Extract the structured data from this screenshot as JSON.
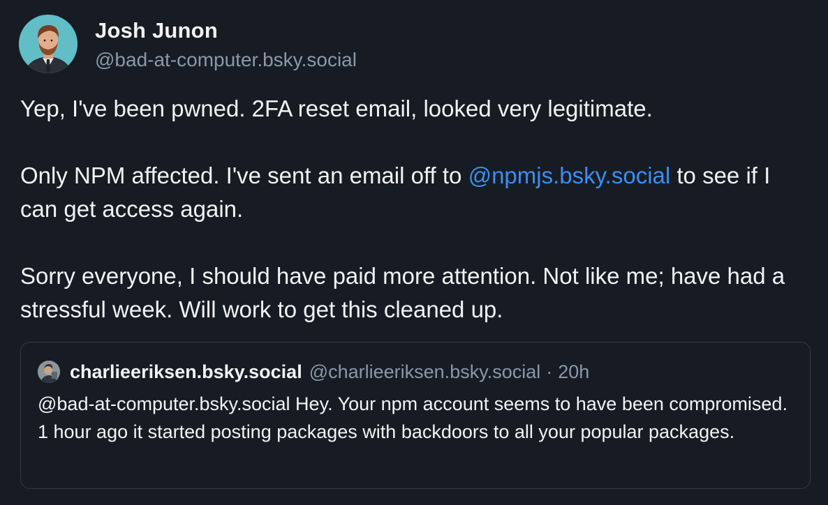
{
  "author": {
    "name": "Josh Junon",
    "handle": "@bad-at-computer.bsky.social",
    "avatar_icon": "profile-photo"
  },
  "post": {
    "paragraph1": "Yep, I've been pwned. 2FA reset email, looked very legitimate.",
    "paragraph2_before": "Only NPM affected. I've sent an email off to ",
    "paragraph2_mention": "@npmjs.bsky.social",
    "paragraph2_after": " to see if I can get access again.",
    "paragraph3": "Sorry everyone, I should have paid more attention. Not like me; have had a stressful week. Will work to get this cleaned up."
  },
  "quote": {
    "name": "charlieeriksen.bsky.social",
    "handle": "@charlieeriksen.bsky.social",
    "separator": "·",
    "time": "20h",
    "text": "@bad-at-computer.bsky.social Hey. Your npm account seems to have been compromised. 1 hour ago it started posting packages with backdoors to all your popular packages.",
    "avatar_icon": "profile-photo"
  },
  "colors": {
    "background": "#171c24",
    "text": "#f1f3f5",
    "muted": "#8b98a8",
    "link": "#3b8ef0",
    "border": "#2f3947"
  }
}
